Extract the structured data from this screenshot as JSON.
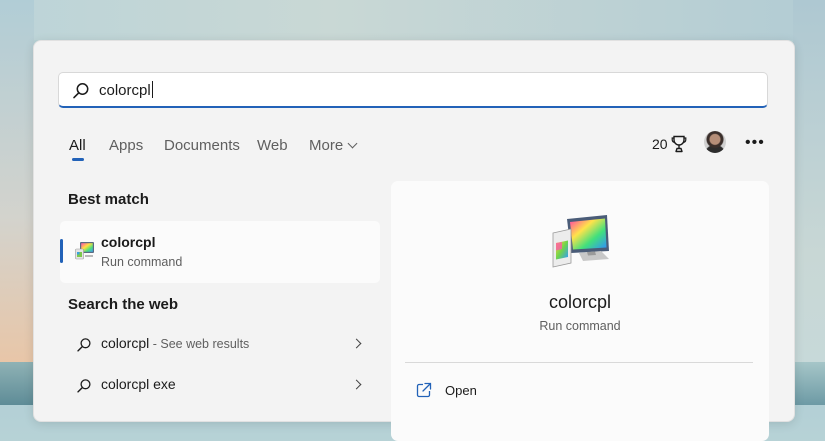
{
  "search": {
    "value": "colorcpl"
  },
  "tabs": [
    {
      "label": "All",
      "active": true
    },
    {
      "label": "Apps"
    },
    {
      "label": "Documents"
    },
    {
      "label": "Web"
    },
    {
      "label": "More"
    }
  ],
  "header": {
    "points": "20",
    "points_icon": "trophy-icon",
    "more_icon": "ellipsis-icon"
  },
  "best_match": {
    "section_title": "Best match",
    "title": "colorcpl",
    "subtitle": "Run command"
  },
  "web": {
    "section_title": "Search the web",
    "results": [
      {
        "query": "colorcpl",
        "suffix": " - See web results"
      },
      {
        "query": "colorcpl exe",
        "suffix": ""
      }
    ]
  },
  "preview": {
    "title": "colorcpl",
    "subtitle": "Run command",
    "actions": [
      {
        "label": "Open",
        "icon": "open-external-icon"
      }
    ]
  },
  "colors": {
    "accent": "#2262b8",
    "panel": "#f3f3f3",
    "card": "#fbfbfb"
  }
}
